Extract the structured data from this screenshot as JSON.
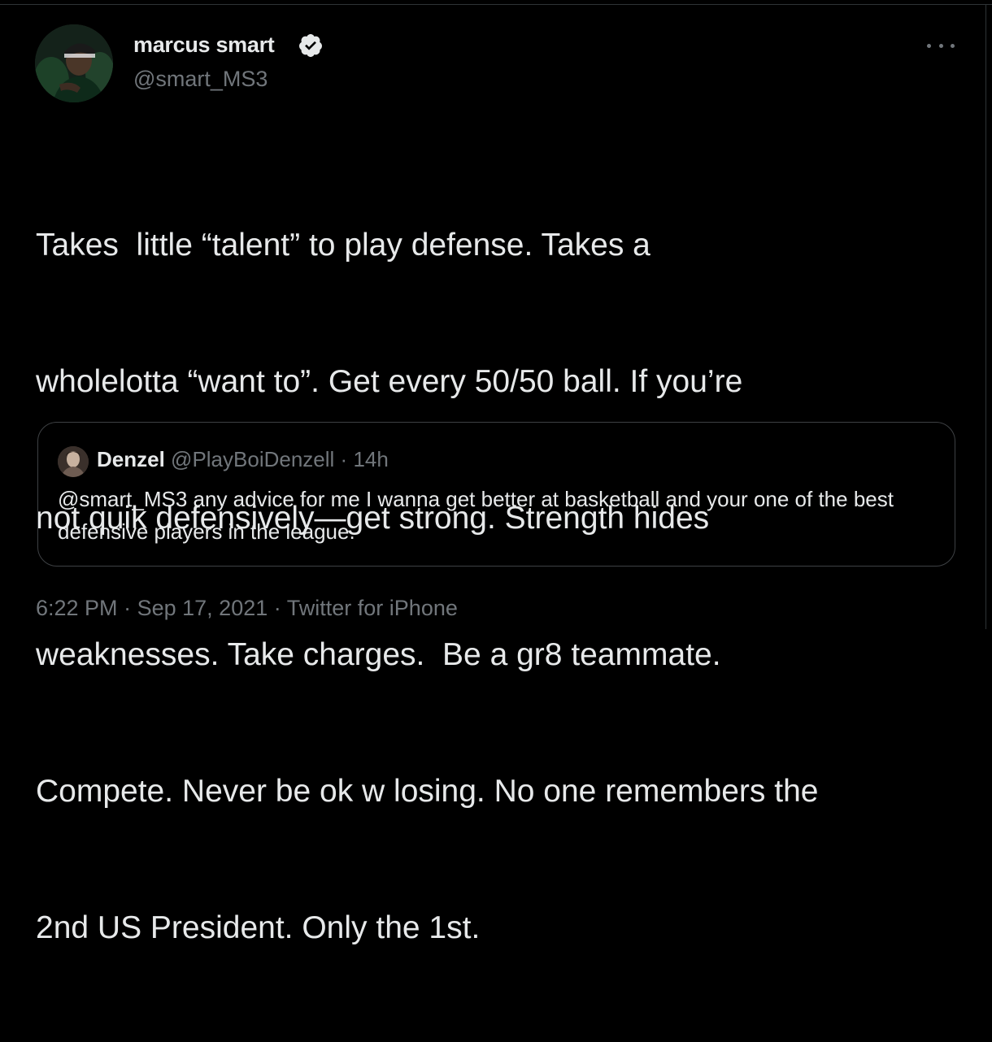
{
  "author": {
    "name": "marcus smart",
    "handle": "@smart_MS3",
    "verified": true
  },
  "tweet": {
    "text": "Takes  little “talent” to play defense. Takes a wholelotta “want to”. Get every 50/50 ball. If you’re not quik defensively—get strong. Strength hides weaknesses. Take charges.  Be a gr8 teammate. Compete. Never be ok w losing. No one remembers the 2nd US President. Only the 1st.",
    "lines": [
      "Takes  little “talent” to play defense. Takes a",
      "wholelotta “want to”. Get every 50/50 ball. If you’re",
      "not quik defensively—get strong. Strength hides",
      "weaknesses. Take charges.  Be a gr8 teammate.",
      "Compete. Never be ok w losing. No one remembers the",
      "2nd US President. Only the 1st."
    ]
  },
  "quoted": {
    "name": "Denzel",
    "handle": "@PlayBoiDenzell",
    "separator": "·",
    "age": "14h",
    "text": "@smart_MS3 any advice for me I wanna get better at basketball and your one of the best defensive players in the league."
  },
  "footer": {
    "time": "6:22 PM",
    "separator": "·",
    "date": "Sep 17, 2021",
    "source": "Twitter for iPhone"
  },
  "icons": {
    "more": "more-horizontal-icon",
    "verified": "verified-badge-icon"
  },
  "colors": {
    "background": "#000000",
    "primary_text": "#e7e9ea",
    "secondary_text": "#71767b",
    "border": "#3e4144"
  }
}
